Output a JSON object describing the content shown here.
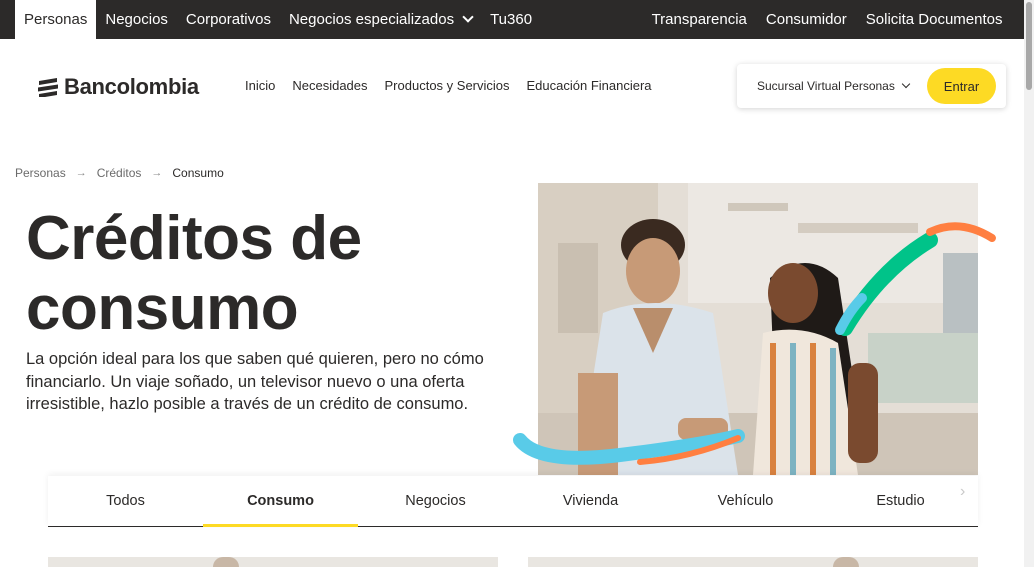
{
  "topbar": {
    "segments": [
      {
        "label": "Personas",
        "active": true
      },
      {
        "label": "Negocios",
        "active": false
      },
      {
        "label": "Corporativos",
        "active": false
      },
      {
        "label": "Negocios especializados",
        "active": false,
        "dropdown": true
      },
      {
        "label": "Tu360",
        "active": false
      }
    ],
    "right_links": [
      "Transparencia",
      "Consumidor",
      "Solicita Documentos"
    ],
    "background_color": "#2c2a29"
  },
  "header": {
    "logo_text": "Bancolombia",
    "nav": [
      "Inicio",
      "Necesidades",
      "Productos y Servicios",
      "Educación Financiera"
    ],
    "login": {
      "select_label": "Sucursal Virtual Personas",
      "button_label": "Entrar",
      "button_color": "#fdda24"
    }
  },
  "breadcrumb": [
    "Personas",
    "Créditos",
    "Consumo"
  ],
  "hero": {
    "title_line1": "Créditos de",
    "title_line2": "consumo",
    "description": "La opción ideal para los que saben qué quieren, pero no cómo financiarlo. Un viaje soñado, un televisor nuevo o una oferta irresistible, hazlo posible a través de un crédito de consumo."
  },
  "tabs": [
    {
      "label": "Todos",
      "active": false
    },
    {
      "label": "Consumo",
      "active": true
    },
    {
      "label": "Negocios",
      "active": false
    },
    {
      "label": "Vivienda",
      "active": false
    },
    {
      "label": "Vehículo",
      "active": false
    },
    {
      "label": "Estudio",
      "active": false
    }
  ],
  "icons": {
    "dropdown": "chevron-down-icon",
    "breadcrumb_separator": "arrow-right-icon",
    "tabs_next": "chevron-right-icon"
  },
  "colors": {
    "accent_yellow": "#fdda24",
    "text_dark": "#2c2a29",
    "deco_green": "#00c389",
    "deco_orange": "#ff7f41",
    "deco_blue": "#59cbe8"
  }
}
